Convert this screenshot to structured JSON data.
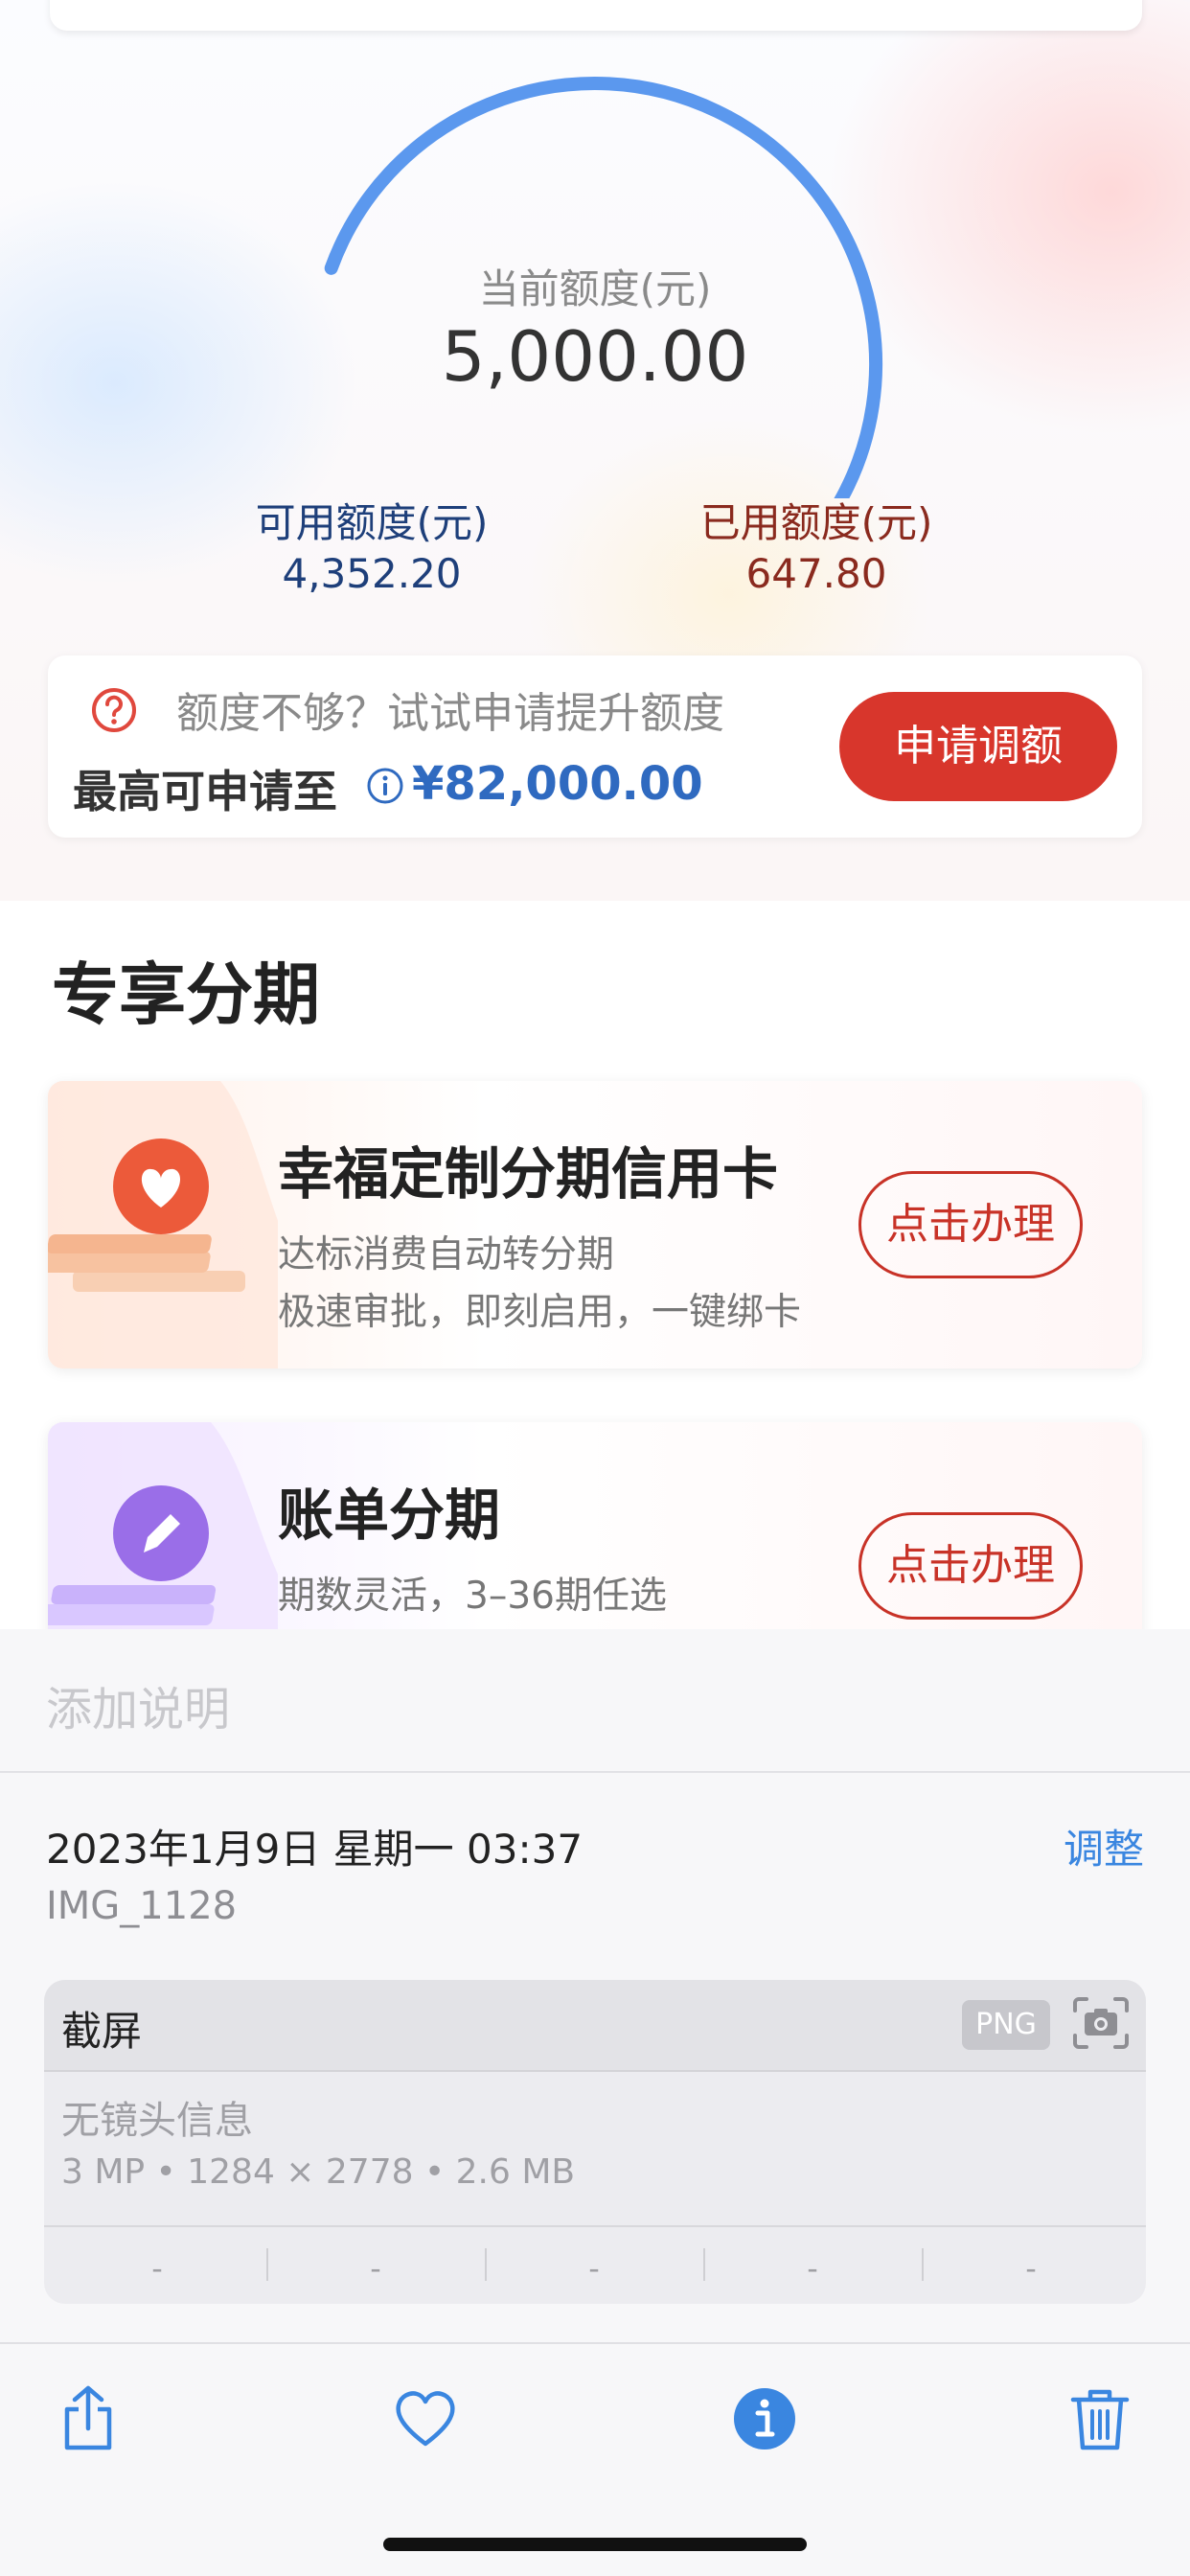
{
  "credit": {
    "current_label": "当前额度(元)",
    "current_value": "5,000.00",
    "available_label": "可用额度(元)",
    "available_value": "4,352.20",
    "used_label": "已用额度(元)",
    "used_value": "647.80",
    "used_fraction": 0.13,
    "colors": {
      "available": "#5b98ee",
      "used": "#ef6a3f"
    }
  },
  "limit_card": {
    "hint": "额度不够？试试申请提升额度",
    "max_label": "最高可申请至",
    "max_value": "¥82,000.00",
    "apply_button": "申请调额"
  },
  "section_title": "专享分期",
  "plans": [
    {
      "title": "幸福定制分期信用卡",
      "subtitle1": "达标消费自动转分期",
      "subtitle2": "极速审批，即刻启用，一键绑卡",
      "button": "点击办理",
      "icon": "heart-icon"
    },
    {
      "title": "账单分期",
      "subtitle1": "期数灵活，3–36期任选",
      "button": "点击办理",
      "icon": "pencil-icon"
    }
  ],
  "photo_info": {
    "caption_placeholder": "添加说明",
    "date": "2023年1月9日 星期一 03:37",
    "adjust": "调整",
    "file_name": "IMG_1128",
    "meta_title": "截屏",
    "format_badge": "PNG",
    "lens": "无镜头信息",
    "specs": "3 MP • 1284 × 2778 • 2.6 MB",
    "exif": [
      "-",
      "-",
      "-",
      "-",
      "-"
    ]
  },
  "toolbar": {
    "icons": [
      "share-icon",
      "heart-icon",
      "info-icon",
      "trash-icon"
    ],
    "accent": "#3a86e0"
  }
}
